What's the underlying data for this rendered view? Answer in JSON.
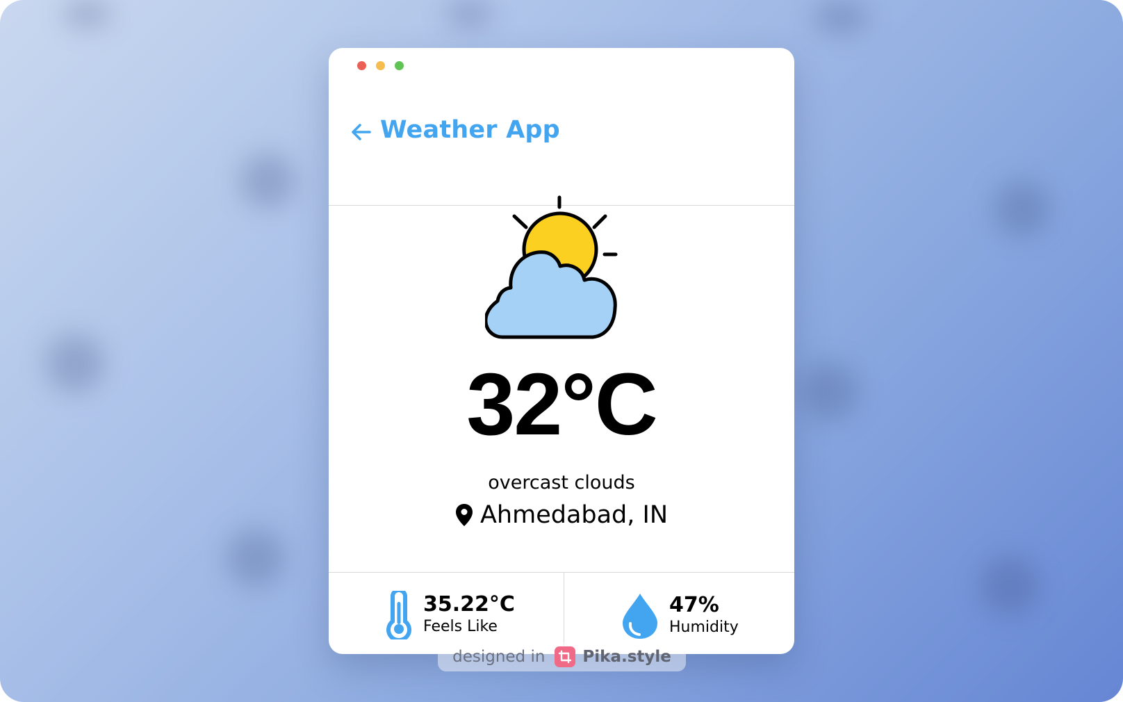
{
  "window": {
    "title": "Weather App",
    "traffic_lights": [
      "#ec5f56",
      "#f5bd4f",
      "#5fc454"
    ]
  },
  "header": {
    "back_icon": "arrow-left-icon",
    "title": "Weather App",
    "accent_color": "#43a5f0"
  },
  "weather": {
    "icon": "partly-cloudy-icon",
    "temperature": "32°C",
    "description": "overcast clouds",
    "location_icon": "map-pin-icon",
    "location": "Ahmedabad, IN"
  },
  "stats": {
    "feels_like": {
      "icon": "thermometer-icon",
      "value": "35.22°C",
      "label": "Feels Like"
    },
    "humidity": {
      "icon": "water-drop-icon",
      "value": "47%",
      "label": "Humidity"
    }
  },
  "watermark": {
    "prefix": "designed in",
    "brand": "Pika.style",
    "logo": "pika-crop-icon"
  }
}
